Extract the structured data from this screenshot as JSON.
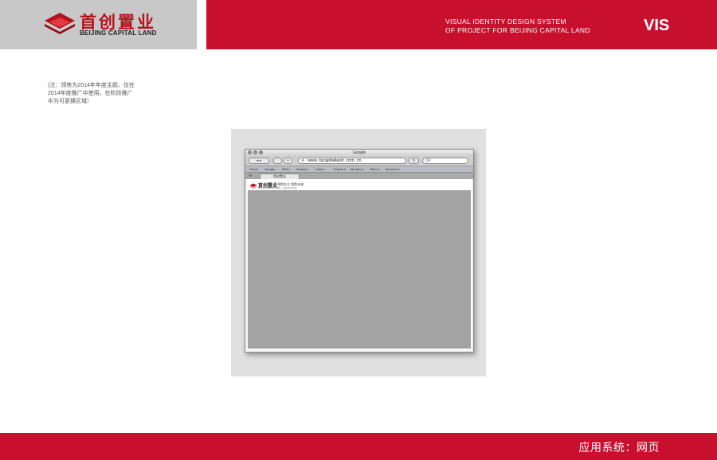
{
  "header": {
    "brand_cn": "首创置业",
    "brand_en": "BEIJING CAPITAL LAND",
    "system_line1": "VISUAL IDENTITY DESIGN SYSTEM",
    "system_line2": "OF PROJECT FOR BEIJING CAPITAL LAND",
    "badge": "VIS"
  },
  "note": {
    "lines": [
      "(注：领势为2014年年度主题，仅在",
      "2014年度推广中使用，在阶段推广",
      "中为可更换区域）"
    ]
  },
  "browser": {
    "window_title": "Google",
    "url": "www. bjcapitalland. com. cn",
    "search_placeholder": "Q▾",
    "bookmarks": [
      "Home",
      "Google",
      "Flickr",
      "Amazon",
      "Lists ▾",
      "Travels ▾",
      "Models ▾",
      "Sites ▾",
      "Taobeoh ▾"
    ],
    "tab_label": "首创置业",
    "site_logo_cn": "首创置业",
    "site_logo_en": "BEIJING CAPITAL LAND",
    "site_tagline": "领势东方 领势未来",
    "site_tagline_sub": "Lead the Future"
  },
  "footer": {
    "section_title": "应用系统：网页"
  },
  "colors": {
    "brand_red": "#c8102e",
    "logo_panel_gray": "#c8c8c8",
    "content_gray": "#a3a3a3"
  },
  "icons": [
    "capital-land-logo-icon",
    "lock-icon",
    "back-icon",
    "forward-icon",
    "close-window-icon",
    "minimize-window-icon",
    "zoom-window-icon"
  ]
}
